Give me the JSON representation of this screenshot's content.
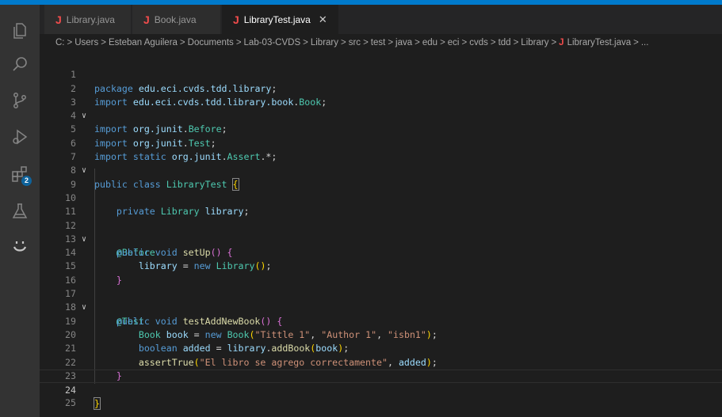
{
  "tabs": [
    {
      "icon": "J",
      "label": "Library.java",
      "active": false
    },
    {
      "icon": "J",
      "label": "Book.java",
      "active": false
    },
    {
      "icon": "J",
      "label": "LibraryTest.java",
      "active": true,
      "close": "✕"
    }
  ],
  "breadcrumb": [
    "C:",
    "Users",
    "Esteban Aguilera",
    "Documents",
    "Lab-03-CVDS",
    "Library",
    "src",
    "test",
    "java",
    "edu",
    "eci",
    "cvds",
    "tdd",
    "Library"
  ],
  "breadcrumb_file": "LibraryTest.java",
  "breadcrumb_tail": "...",
  "breadcrumb_separator": ">",
  "activity_badge": "2",
  "fold_marker": "∨",
  "line_numbers": [
    "1",
    "2",
    "3",
    "4",
    "5",
    "6",
    "7",
    "8",
    "9",
    "10",
    "11",
    "12",
    "13",
    "14",
    "15",
    "16",
    "17",
    "18",
    "19",
    "20",
    "21",
    "22",
    "23",
    "24",
    "25"
  ],
  "current_line": "24",
  "code": {
    "l1_kw": "package",
    "l1_pkg": "edu.eci.cvds.tdd.library",
    "l2_kw": "import",
    "l2_pkg": "edu.eci.cvds.tdd.library.book",
    "l2_cls": "Book",
    "l4_kw": "import",
    "l4_pkg": "org.junit",
    "l4_cls": "Before",
    "l5_kw": "import",
    "l5_pkg": "org.junit",
    "l5_cls": "Test",
    "l6_kw": "import static",
    "l6_pkg": "org.junit",
    "l6_cls": "Assert",
    "l8_kw": "public class",
    "l8_cls": "LibraryTest",
    "l10_kw": "private",
    "l10_type": "Library",
    "l10_var": "library",
    "l12_ann": "@Before",
    "l13_kw": "public void",
    "l13_fn": "setUp",
    "l14_var": "library",
    "l14_new": "new",
    "l14_type": "Library",
    "l17_ann": "@Test",
    "l18_kw": "public void",
    "l18_fn": "testAddNewBook",
    "l19_type": "Book",
    "l19_var": "book",
    "l19_new": "new",
    "l19_ctor": "Book",
    "l19_s1": "\"Tittle 1\"",
    "l19_s2": "\"Author 1\"",
    "l19_s3": "\"isbn1\"",
    "l20_kw": "boolean",
    "l20_var": "added",
    "l20_obj": "library",
    "l20_fn": "addBook",
    "l20_arg": "book",
    "l21_fn": "assertTrue",
    "l21_str": "\"El libro se agrego correctamente\"",
    "l21_arg": "added"
  }
}
